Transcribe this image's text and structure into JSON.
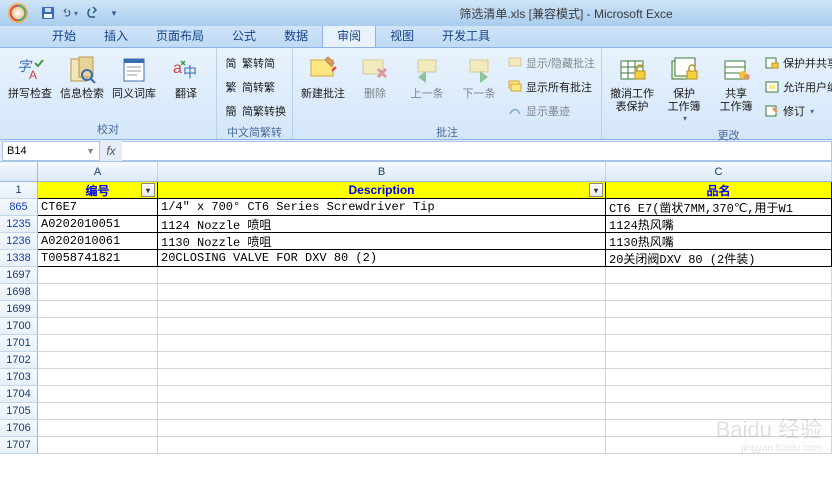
{
  "title": "筛选清单.xls [兼容模式] - Microsoft Exce",
  "qat": {
    "save": "保存",
    "undo": "撤销",
    "redo": "重做"
  },
  "tabs": [
    "开始",
    "插入",
    "页面布局",
    "公式",
    "数据",
    "审阅",
    "视图",
    "开发工具"
  ],
  "active_tab": 5,
  "ribbon": {
    "g1": {
      "label": "校对",
      "spell": "拼写检查",
      "research": "信息检索",
      "thesaurus": "同义词库",
      "translate": "翻译"
    },
    "g2": {
      "label": "中文简繁转换",
      "sc": "繁转简",
      "tc": "简转繁",
      "conv": "简繁转换"
    },
    "g3": {
      "label": "批注",
      "newc": "新建批注",
      "del": "删除",
      "prev": "上一条",
      "next": "下一条",
      "showhide": "显示/隐藏批注",
      "showall": "显示所有批注",
      "ink": "显示墨迹"
    },
    "g4": {
      "label": "更改",
      "unprotect": "撤消工作\n表保护",
      "protectwb": "保护\n工作簿",
      "share": "共享\n工作簿",
      "protshare": "保护并共享工",
      "allowedit": "允许用户编辑",
      "track": "修订"
    }
  },
  "namebox": "B14",
  "columns": [
    "A",
    "B",
    "C"
  ],
  "headers": {
    "A": "编号",
    "B": "Description",
    "C": "品名"
  },
  "rows": [
    {
      "n": 865,
      "A": "CT6E7",
      "B": "1/4″ x 700° CT6 Series Screwdriver Tip",
      "C": "CT6 E7(凿状7MM,370℃,用于W1"
    },
    {
      "n": 1235,
      "A": "A0202010051",
      "B": "1124 Nozzle 喷咀",
      "C": "1124热风嘴"
    },
    {
      "n": 1236,
      "A": "A0202010061",
      "B": "1130 Nozzle 喷咀",
      "C": "1130热风嘴"
    },
    {
      "n": 1338,
      "A": "T0058741821",
      "B": "20CLOSING VALVE FOR DXV 80 (2)",
      "C": "20关闭阀DXV 80 (2件装)"
    }
  ],
  "empty_rows": [
    1697,
    1698,
    1699,
    1700,
    1701,
    1702,
    1703,
    1704,
    1705,
    1706,
    1707
  ],
  "watermark": "Baidu 经验",
  "watermark_url": "jingyan.baidu.com"
}
